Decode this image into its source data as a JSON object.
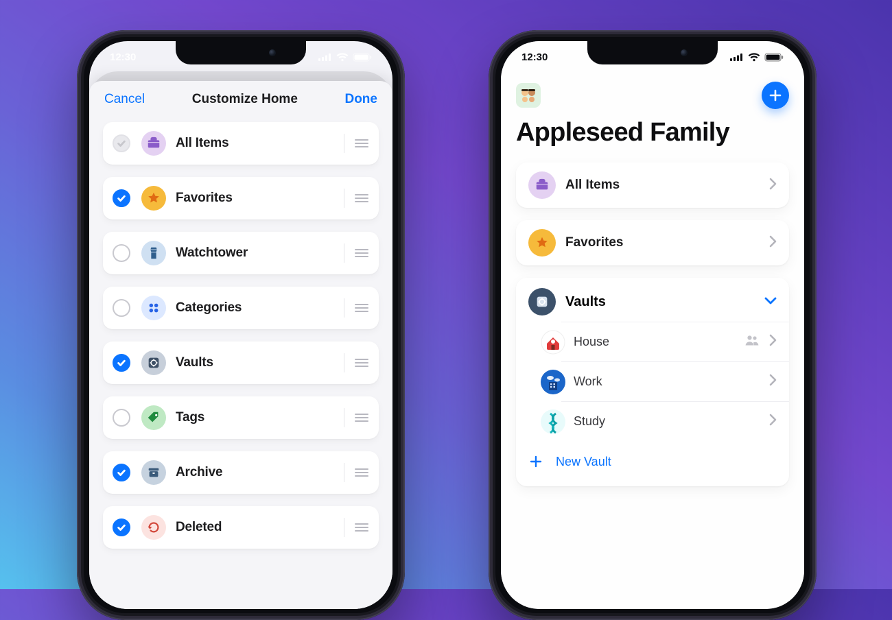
{
  "colors": {
    "accent": "#0b74ff",
    "text": "#1d1d1f",
    "muted": "#b8b8c0"
  },
  "status": {
    "time": "12:30"
  },
  "left": {
    "nav": {
      "cancel": "Cancel",
      "title": "Customize Home",
      "done": "Done"
    },
    "items": [
      {
        "id": "all",
        "label": "All Items",
        "selected": "disabled",
        "iconBg": "#e4d1f2",
        "iconFg": "#8a5cc9"
      },
      {
        "id": "favorites",
        "label": "Favorites",
        "selected": "checked",
        "iconBg": "#f6ba3b",
        "iconFg": "#e06a12"
      },
      {
        "id": "watchtower",
        "label": "Watchtower",
        "selected": "unchecked",
        "iconBg": "#cfe0f2",
        "iconFg": "#2f5e8d"
      },
      {
        "id": "categories",
        "label": "Categories",
        "selected": "unchecked",
        "iconBg": "#dce8ff",
        "iconFg": "#2763e6"
      },
      {
        "id": "vaults",
        "label": "Vaults",
        "selected": "checked",
        "iconBg": "#c7cfda",
        "iconFg": "#3e5066"
      },
      {
        "id": "tags",
        "label": "Tags",
        "selected": "unchecked",
        "iconBg": "#bfe9c3",
        "iconFg": "#1f8a3d"
      },
      {
        "id": "archive",
        "label": "Archive",
        "selected": "checked",
        "iconBg": "#c6d2df",
        "iconFg": "#3a5a7a"
      },
      {
        "id": "deleted",
        "label": "Deleted",
        "selected": "checked",
        "iconBg": "#fce3e0",
        "iconFg": "#d2483b"
      }
    ]
  },
  "right": {
    "account": {
      "name": "Appleseed Family"
    },
    "quick": [
      {
        "id": "all",
        "label": "All Items",
        "iconBg": "#e4d1f2",
        "iconFg": "#8a5cc9"
      },
      {
        "id": "favorites",
        "label": "Favorites",
        "iconBg": "#f6ba3b",
        "iconFg": "#e06a12"
      }
    ],
    "vaultsSection": {
      "label": "Vaults",
      "iconBg": "#3c516a",
      "iconFg": "#d9e3ef",
      "newLabel": "New Vault",
      "vaults": [
        {
          "id": "house",
          "label": "House",
          "shared": true,
          "bg": "#ffffff",
          "ring": "#e13b3b"
        },
        {
          "id": "work",
          "label": "Work",
          "shared": false,
          "bg": "#1b66c9",
          "ring": "#1b66c9"
        },
        {
          "id": "study",
          "label": "Study",
          "shared": false,
          "bg": "#19c3c8",
          "ring": "#19c3c8"
        }
      ]
    }
  }
}
